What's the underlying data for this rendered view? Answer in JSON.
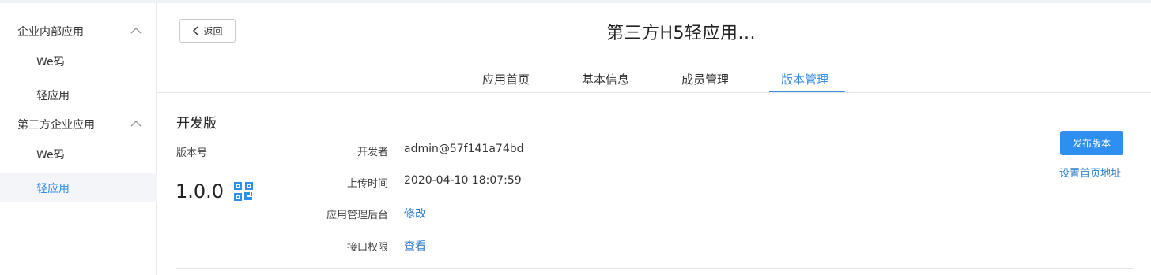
{
  "sidebar": {
    "groups": [
      {
        "label": "企业内部应用",
        "items": [
          {
            "label": "We码"
          },
          {
            "label": "轻应用"
          }
        ]
      },
      {
        "label": "第三方企业应用",
        "items": [
          {
            "label": "We码"
          },
          {
            "label": "轻应用",
            "active": true
          }
        ]
      }
    ]
  },
  "header": {
    "back_label": "返回",
    "title": "第三方H5轻应用..."
  },
  "tabs": [
    {
      "label": "应用首页"
    },
    {
      "label": "基本信息"
    },
    {
      "label": "成员管理"
    },
    {
      "label": "版本管理",
      "active": true
    }
  ],
  "dev": {
    "section_title": "开发版",
    "version_label": "版本号",
    "version": "1.0.0",
    "rows": [
      {
        "label": "开发者",
        "value": "admin@57f141a74bd"
      },
      {
        "label": "上传时间",
        "value": "2020-04-10 18:07:59"
      },
      {
        "label": "应用管理后台",
        "value": "修改"
      },
      {
        "label": "接口权限",
        "value": "查看"
      }
    ],
    "publish_label": "发布版本",
    "set_home_label": "设置首页地址"
  },
  "colors": {
    "accent": "#3a8ee6",
    "button": "#2f8ff0",
    "link": "#2d7ec9"
  }
}
